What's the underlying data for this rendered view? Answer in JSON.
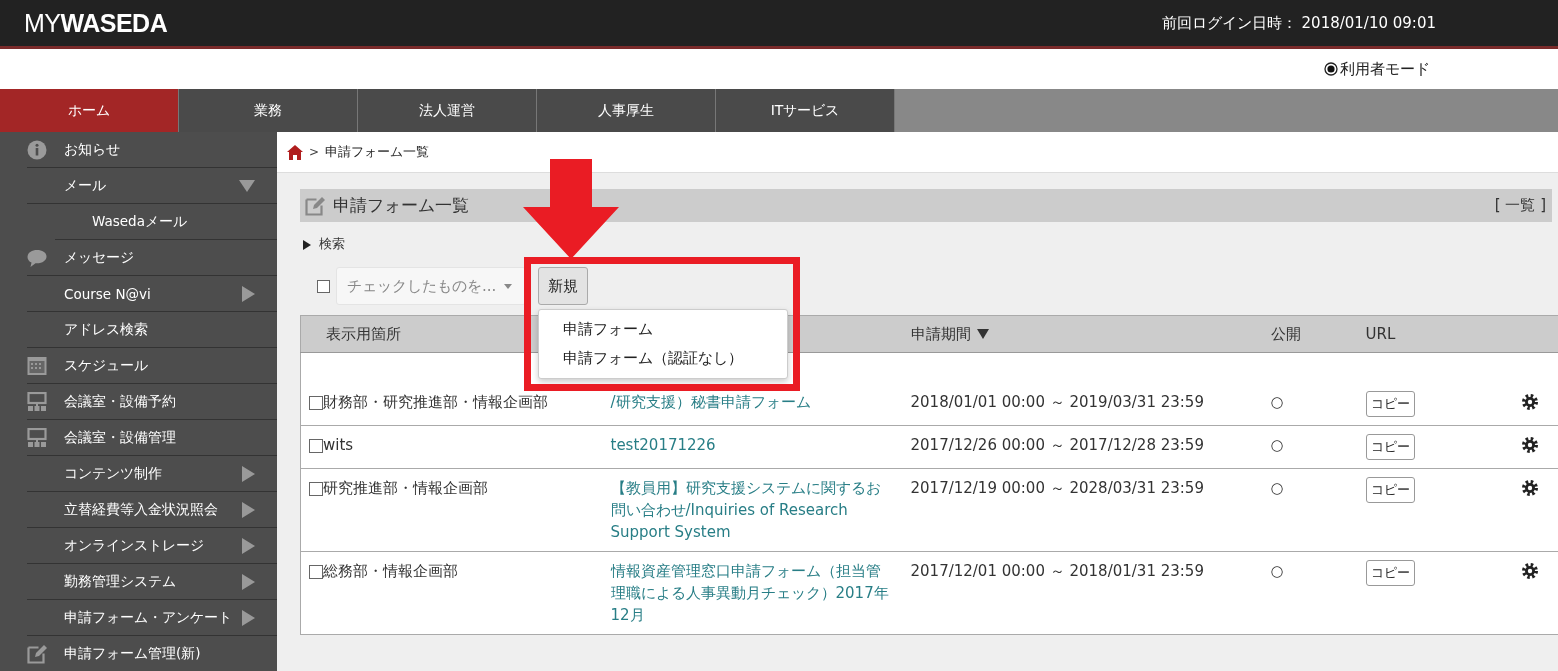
{
  "header": {
    "logo": "MY**WASEDA**",
    "last_login": "前回ログイン日時： 2018/01/10 09:01"
  },
  "mode": {
    "label": "利用者モード",
    "selected": true
  },
  "nav_tabs": [
    {
      "label": "ホーム",
      "selected": true
    },
    {
      "label": "業務",
      "selected": false
    },
    {
      "label": "法人運営",
      "selected": false
    },
    {
      "label": "人事厚生",
      "selected": false
    },
    {
      "label": "ITサービス",
      "selected": false
    }
  ],
  "sidebar": {
    "items": [
      {
        "label": "お知らせ",
        "kind": "info"
      },
      {
        "label": "メール",
        "expanded": true,
        "children": [
          {
            "label": "Wasedaメール"
          }
        ]
      },
      {
        "label": "メッセージ",
        "kind": "chat"
      },
      {
        "label": "Course N@vi",
        "expanded": false
      },
      {
        "label": "アドレス検索"
      },
      {
        "label": "スケジュール",
        "kind": "calendar"
      },
      {
        "label": "会議室・設備予約",
        "kind": "room"
      },
      {
        "label": "会議室・設備管理",
        "kind": "room"
      },
      {
        "label": "コンテンツ制作",
        "expanded": false
      },
      {
        "label": "立替経費等入金状況照会",
        "expanded": false
      },
      {
        "label": "オンラインストレージ",
        "expanded": false
      },
      {
        "label": "勤務管理システム",
        "expanded": false
      },
      {
        "label": "申請フォーム・アンケート",
        "expanded": false
      },
      {
        "label": "申請フォーム管理(新)",
        "kind": "edit"
      }
    ]
  },
  "breadcrumb": {
    "separator": ">",
    "items": [
      "申請フォーム一覧"
    ]
  },
  "panel": {
    "title": "申請フォーム一覧",
    "list_link": "[ 一覧 ]",
    "search": {
      "label": "検索",
      "expanded": false
    }
  },
  "toolbar": {
    "select_all_checked": false,
    "bulk_action": "チェックしたものを...",
    "new_button": "新規",
    "new_menu": {
      "open": true,
      "items": [
        "申請フォーム",
        "申請フォーム（認証なし）"
      ]
    }
  },
  "table": {
    "headers": [
      {
        "label": "表示用箇所"
      },
      {
        "label": "申請期間",
        "sorted_descending": true
      },
      {
        "label": "公開"
      },
      {
        "label": "URL"
      }
    ],
    "rows": [
      {
        "checked": false,
        "location": "財務部・研究推進部・情報企画部",
        "form": "/研究支援）秘書申請フォーム",
        "period": "2018/01/01 00:00 ～ 2019/03/31 23:59",
        "public": "○",
        "url_button": "コピー"
      },
      {
        "checked": false,
        "location": "wits",
        "form": "test20171226",
        "period": "2017/12/26 00:00 ～ 2017/12/28 23:59",
        "public": "○",
        "url_button": "コピー"
      },
      {
        "checked": false,
        "location": "研究推進部・情報企画部",
        "form": "【教員用】研究支援システムに関するお問い合わせ/Inquiries of Research Support System",
        "period": "2017/12/19 00:00 ～ 2028/03/31 23:59",
        "public": "○",
        "url_button": "コピー"
      },
      {
        "checked": false,
        "location": "総務部・情報企画部",
        "form": "情報資産管理窓口申請フォーム（担当管理職による人事異動月チェック）2017年12月",
        "period": "2017/12/01 00:00 ～ 2018/01/31 23:59",
        "public": "○",
        "url_button": "コピー"
      }
    ]
  },
  "annotation": {
    "arrow": true,
    "frame": true
  }
}
